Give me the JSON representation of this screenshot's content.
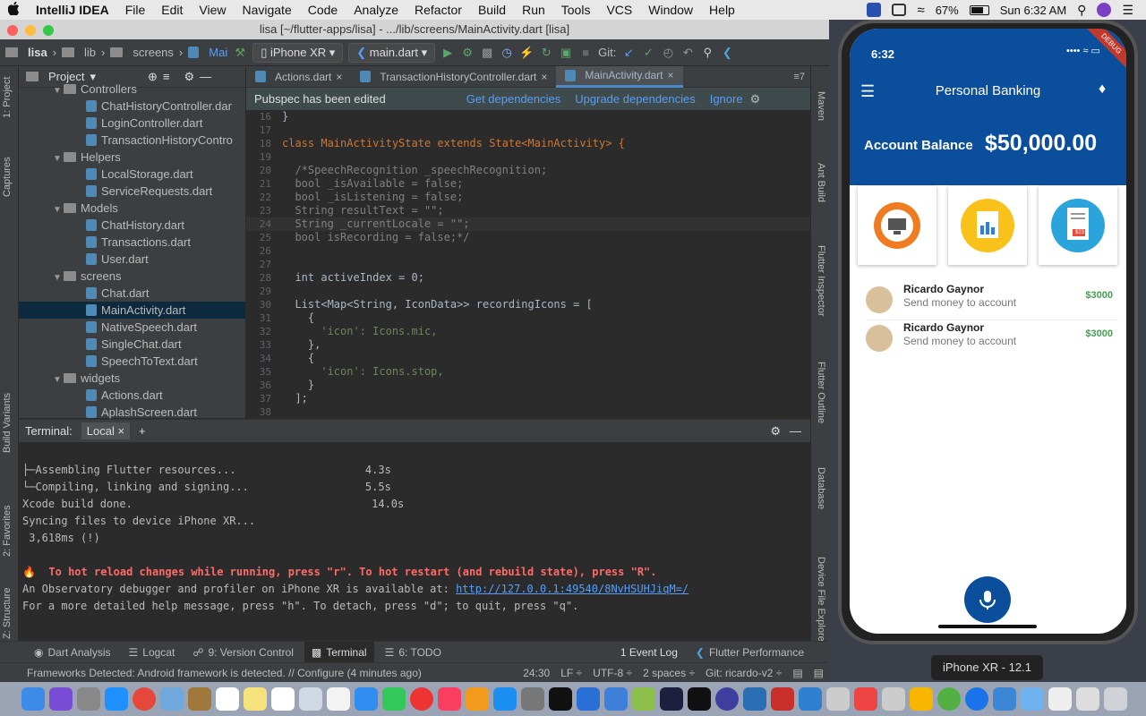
{
  "menubar": {
    "apple": "",
    "app": "IntelliJ IDEA",
    "menus": [
      "File",
      "Edit",
      "View",
      "Navigate",
      "Code",
      "Analyze",
      "Refactor",
      "Build",
      "Run",
      "Tools",
      "VCS",
      "Window",
      "Help"
    ],
    "battery": "67%",
    "clock": "Sun 6:32 AM"
  },
  "window": {
    "title": "lisa [~/flutter-apps/lisa] - .../lib/screens/MainActivity.dart [lisa]"
  },
  "navbar": {
    "crumbs": [
      "lisa",
      "lib",
      "screens",
      "Mai"
    ],
    "device": "iPhone XR",
    "config": "main.dart",
    "git_label": "Git:"
  },
  "project": {
    "header": "Project",
    "items": [
      {
        "name": "Controllers",
        "type": "folder",
        "level": 1
      },
      {
        "name": "ChatHistoryController.dar",
        "type": "file",
        "level": 2
      },
      {
        "name": "LoginController.dart",
        "type": "file",
        "level": 2
      },
      {
        "name": "TransactionHistoryContro",
        "type": "file",
        "level": 2
      },
      {
        "name": "Helpers",
        "type": "folder",
        "level": 1
      },
      {
        "name": "LocalStorage.dart",
        "type": "file",
        "level": 2
      },
      {
        "name": "ServiceRequests.dart",
        "type": "file",
        "level": 2
      },
      {
        "name": "Models",
        "type": "folder",
        "level": 1
      },
      {
        "name": "ChatHistory.dart",
        "type": "file",
        "level": 2
      },
      {
        "name": "Transactions.dart",
        "type": "file",
        "level": 2
      },
      {
        "name": "User.dart",
        "type": "file",
        "level": 2
      },
      {
        "name": "screens",
        "type": "folder",
        "level": 1
      },
      {
        "name": "Chat.dart",
        "type": "file",
        "level": 2
      },
      {
        "name": "MainActivity.dart",
        "type": "file",
        "level": 2,
        "selected": true
      },
      {
        "name": "NativeSpeech.dart",
        "type": "file",
        "level": 2
      },
      {
        "name": "SingleChat.dart",
        "type": "file",
        "level": 2
      },
      {
        "name": "SpeechToText.dart",
        "type": "file",
        "level": 2
      },
      {
        "name": "widgets",
        "type": "folder",
        "level": 1
      },
      {
        "name": "Actions.dart",
        "type": "file",
        "level": 2
      },
      {
        "name": "AplashScreen.dart",
        "type": "file",
        "level": 2
      }
    ]
  },
  "left_stripe": [
    "1: Project",
    "Captures",
    "Build Variants",
    "2: Favorites",
    "Z: Structure"
  ],
  "right_stripe": [
    "Maven",
    "Ant Build",
    "Flutter Inspector",
    "Flutter Outline",
    "Database",
    "Device File Explorer"
  ],
  "tabs": [
    {
      "label": "Actions.dart"
    },
    {
      "label": "TransactionHistoryController.dart"
    },
    {
      "label": "MainActivity.dart",
      "active": true
    }
  ],
  "tabs_overflow": "≡7",
  "banner": {
    "message": "Pubspec has been edited",
    "links": [
      "Get dependencies",
      "Upgrade dependencies",
      "Ignore"
    ]
  },
  "code": [
    {
      "n": "16",
      "t": "}"
    },
    {
      "n": "17",
      "t": ""
    },
    {
      "n": "18",
      "t": "class MainActivityState extends State<MainActivity> {"
    },
    {
      "n": "19",
      "t": ""
    },
    {
      "n": "20",
      "t": "  /*SpeechRecognition _speechRecognition;"
    },
    {
      "n": "21",
      "t": "  bool _isAvailable = false;"
    },
    {
      "n": "22",
      "t": "  bool _isListening = false;"
    },
    {
      "n": "23",
      "t": "  String resultText = \"\";"
    },
    {
      "n": "24",
      "t": "  String _currentLocale = \"\";"
    },
    {
      "n": "25",
      "t": "  bool isRecording = false;*/"
    },
    {
      "n": "26",
      "t": ""
    },
    {
      "n": "27",
      "t": ""
    },
    {
      "n": "28",
      "t": "  int activeIndex = 0;"
    },
    {
      "n": "29",
      "t": ""
    },
    {
      "n": "30",
      "t": "  List<Map<String, IconData>> recordingIcons = ["
    },
    {
      "n": "31",
      "t": "    {"
    },
    {
      "n": "32",
      "t": "      'icon': Icons.mic,"
    },
    {
      "n": "33",
      "t": "    },"
    },
    {
      "n": "34",
      "t": "    {"
    },
    {
      "n": "35",
      "t": "      'icon': Icons.stop,"
    },
    {
      "n": "36",
      "t": "    }"
    },
    {
      "n": "37",
      "t": "  ];"
    },
    {
      "n": "38",
      "t": ""
    }
  ],
  "terminal": {
    "title": "Terminal:",
    "tab": "Local",
    "lines": [
      {
        "t": "├─Assembling Flutter resources...                    4.3s"
      },
      {
        "t": "└─Compiling, linking and signing...                  5.5s"
      },
      {
        "t": "Xcode build done.                                     14.0s"
      },
      {
        "t": "Syncing files to device iPhone XR..."
      },
      {
        "t": " 3,618ms (!)"
      },
      {
        "t": ""
      },
      {
        "t": "🔥  To hot reload changes while running, press \"r\". To hot restart (and rebuild state), press \"R\".",
        "red": true
      },
      {
        "t": "An Observatory debugger and profiler on iPhone XR is available at: ",
        "link": "http://127.0.0.1:49540/8NvHSUHJiqM=/"
      },
      {
        "t": "For a more detailed help message, press \"h\". To detach, press \"d\"; to quit, press \"q\"."
      }
    ]
  },
  "toolwindows": [
    "Dart Analysis",
    "Logcat",
    "9: Version Control",
    "Terminal",
    "6: TODO",
    "1 Event Log",
    "Flutter Performance"
  ],
  "status": {
    "message": "Frameworks Detected: Android framework is detected. // Configure (4 minutes ago)",
    "pos": "24:30",
    "lf": "LF ÷",
    "enc": "UTF-8 ÷",
    "indent": "2 spaces ÷",
    "git": "Git: ricardo-v2 ÷"
  },
  "phone": {
    "time": "6:32",
    "debug": "DEBUG",
    "app_title": "Personal Banking",
    "balance_label": "Account Balance",
    "balance": "$50,000.00",
    "transactions": [
      {
        "name": "Ricardo Gaynor",
        "desc": "Send money to account",
        "amount": "$3000"
      },
      {
        "name": "Ricardo Gaynor",
        "desc": "Send money to account",
        "amount": "$3000"
      }
    ],
    "receipt_amount": "$23",
    "label": "iPhone XR - 12.1"
  },
  "colors": {
    "bank_blue": "#0b4f9c",
    "amount_green": "#3fa34d",
    "ide_bg": "#2b2b2b"
  }
}
